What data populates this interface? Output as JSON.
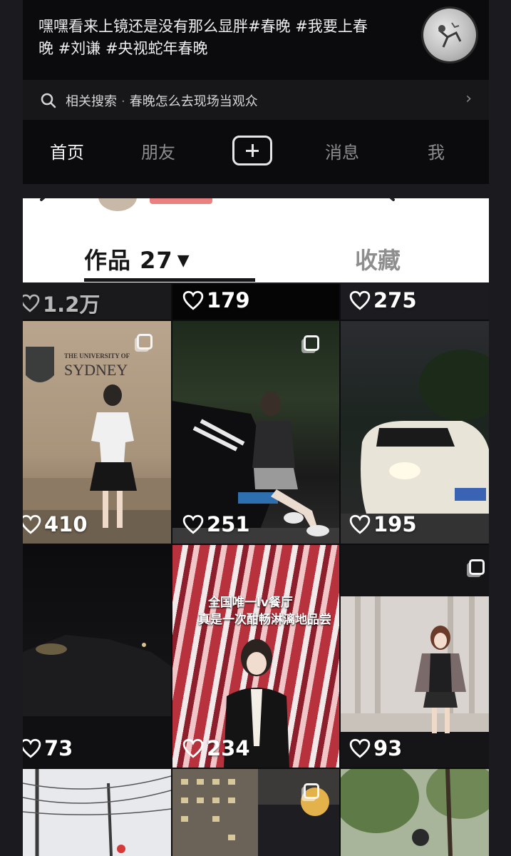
{
  "video": {
    "username_cut": "_",
    "caption": "嘿嘿看来上镜还是没有那么显胖#春晚 #我要上春晚 #刘谦 #央视蛇年春晚"
  },
  "related": {
    "label": "相关搜索",
    "separator": "·",
    "query": "春晚怎么去现场当观众",
    "arrow": "›"
  },
  "nav": {
    "home": "首页",
    "friends": "朋友",
    "messages": "消息",
    "me": "我"
  },
  "profile": {
    "tab_works": "作品 27",
    "tab_works_caret": "▼",
    "tab_favorites": "收藏"
  },
  "grid": {
    "top_row_likes": [
      "1.2万",
      "179",
      "275"
    ],
    "posts": [
      {
        "likes": "410",
        "sign_line1": "THE UNIVERSITY OF",
        "sign_line2": "SYDNEY"
      },
      {
        "likes": "251"
      },
      {
        "likes": "195"
      },
      {
        "likes": "73"
      },
      {
        "likes": "234",
        "overlay_line1": "全国唯一lv餐厅",
        "overlay_line2": "真是一次酣畅淋漓地品尝"
      },
      {
        "likes": "93"
      }
    ]
  },
  "colors": {
    "background": "#1b1b1f",
    "panel": "#0b0b0d",
    "profile_bg": "#ffffff",
    "text_light": "#eeeeee",
    "text_dim": "#8d8d8d"
  }
}
